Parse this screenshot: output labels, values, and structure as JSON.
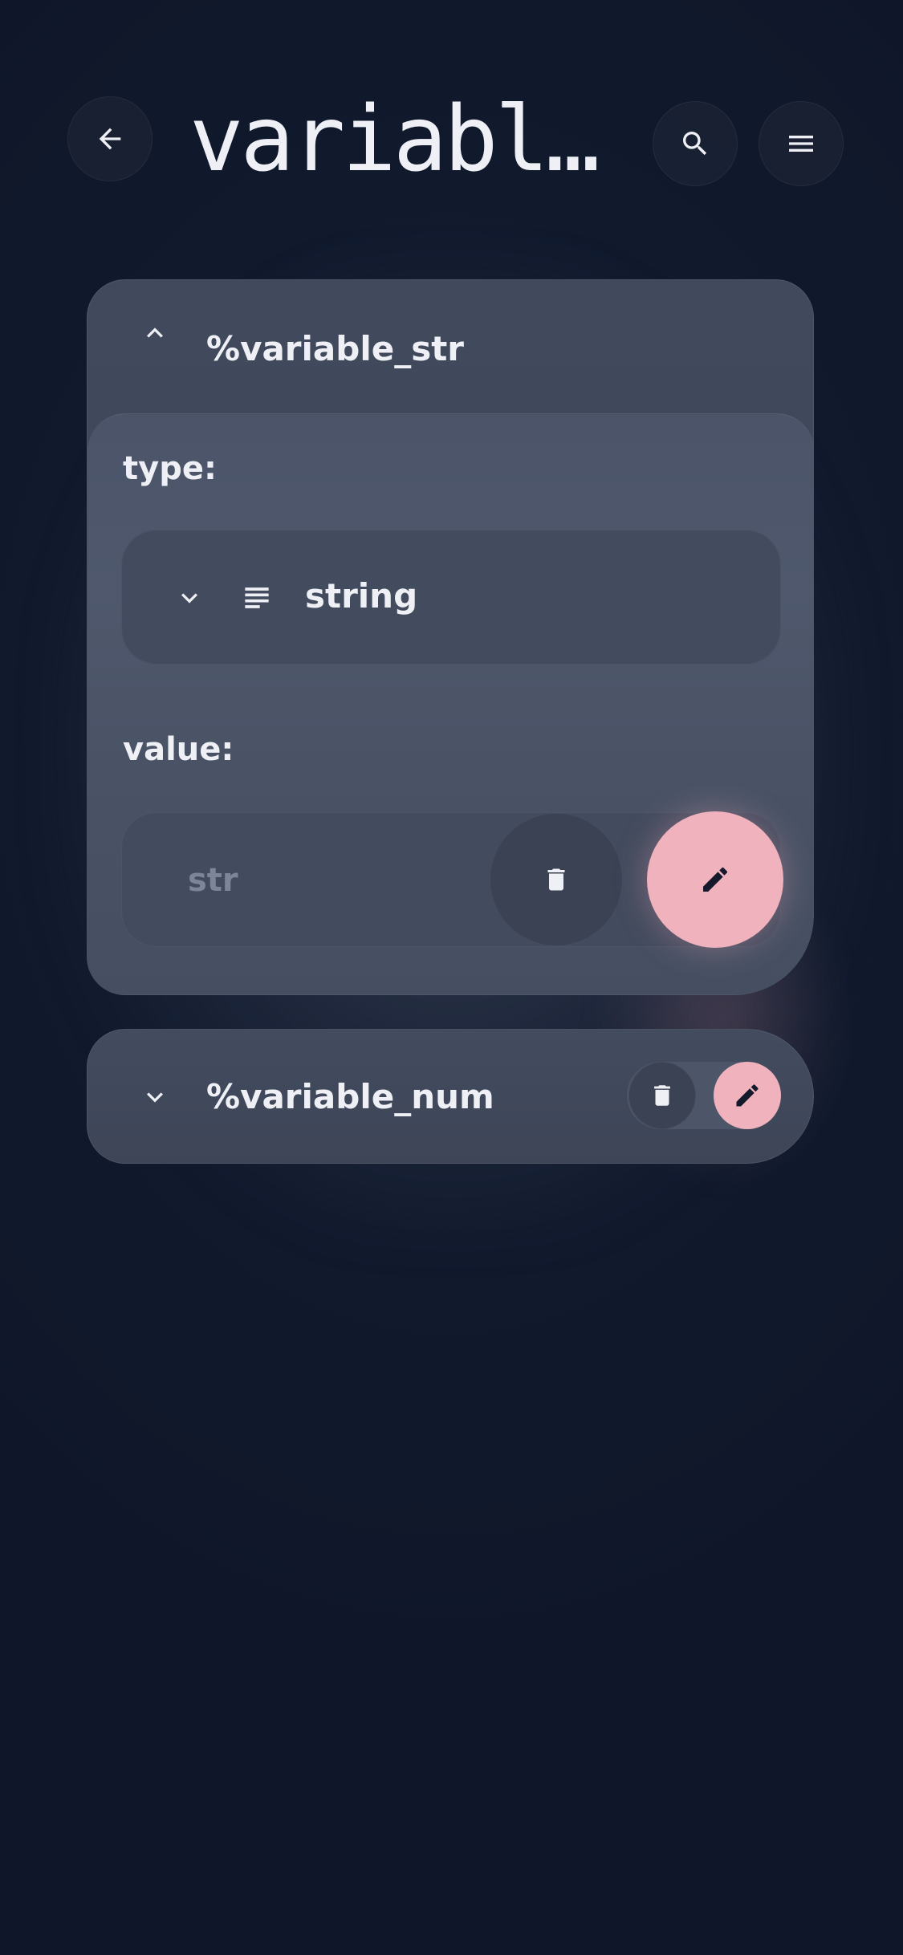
{
  "header": {
    "title": "variabl…",
    "back_icon": "arrow-left-icon",
    "search_icon": "search-icon",
    "menu_icon": "hamburger-menu-icon"
  },
  "variables": [
    {
      "name": "%variable_str",
      "expanded": true,
      "type_label": "type:",
      "type_value": "string",
      "value_label": "value:",
      "value_placeholder": "str"
    },
    {
      "name": "%variable_num",
      "expanded": false
    }
  ],
  "colors": {
    "background": "#0f1629",
    "card": "#414a5d",
    "accent_pink": "#f0b3bd",
    "text": "#eef0f5",
    "muted_text": "#7d8598"
  }
}
